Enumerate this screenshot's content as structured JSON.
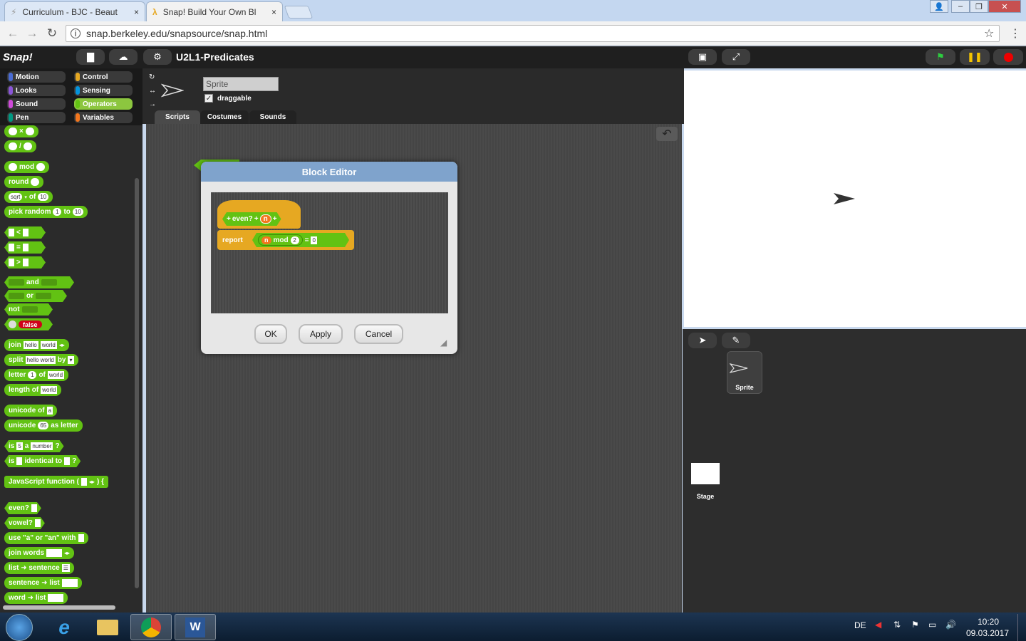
{
  "browser": {
    "tabs": [
      {
        "title": "Curriculum - BJC - Beaut",
        "close": "×"
      },
      {
        "title": "Snap! Build Your Own Bl",
        "close": "×"
      }
    ],
    "url": "snap.berkeley.edu/snapsource/snap.html",
    "window_buttons": [
      "user",
      "minimize",
      "restore",
      "close"
    ]
  },
  "snap": {
    "logo": "Snap!",
    "project_title": "U2L1-Predicates",
    "categories": [
      {
        "label": "Motion",
        "color": "#4a6cd4"
      },
      {
        "label": "Control",
        "color": "#e6a822"
      },
      {
        "label": "Looks",
        "color": "#8a55d7"
      },
      {
        "label": "Sensing",
        "color": "#0494dc"
      },
      {
        "label": "Sound",
        "color": "#cf4ad9"
      },
      {
        "label": "Operators",
        "color": "#62c213"
      },
      {
        "label": "Pen",
        "color": "#009982"
      },
      {
        "label": "Variables",
        "color": "#f3761d"
      }
    ],
    "selected_category": "Operators",
    "palette": {
      "times": "×",
      "divide": "/",
      "mod": "mod",
      "round": "round",
      "sqrt": "sqrt",
      "of": "of",
      "ten": "10",
      "pick_random": "pick random",
      "one": "1",
      "to": "to",
      "lt": "<",
      "eq": "=",
      "gt": ">",
      "and": "and",
      "or": "or",
      "not": "not",
      "false": "false",
      "join": "join",
      "hello": "hello",
      "world": "world",
      "split": "split",
      "hello_world": "hello world",
      "by": "by",
      "letter": "letter",
      "length_of": "length of",
      "unicode_of": "unicode of",
      "a": "a",
      "unicode": "unicode",
      "sixtyfive": "65",
      "as_letter": "as letter",
      "is": "is",
      "five": "5",
      "a_word": "a",
      "number": "number",
      "question": "?",
      "identical_to": "identical to",
      "js_function": "JavaScript function (",
      "js_close": ") {",
      "even": "even?",
      "vowel": "vowel?",
      "use_a_an": "use \"a\" or \"an\" with",
      "join_words": "join words",
      "list_sentence": "list ➜ sentence",
      "sentence_list": "sentence ➜ list",
      "word_list": "word ➜ list"
    },
    "sprite": {
      "name": "Sprite",
      "draggable_label": "draggable",
      "draggable": true
    },
    "tabs": [
      "Scripts",
      "Costumes",
      "Sounds"
    ],
    "block_editor": {
      "title": "Block Editor",
      "hat": {
        "plus": "+",
        "name": "even?",
        "param": "n"
      },
      "report": {
        "label": "report",
        "var": "n",
        "op": "mod",
        "divisor": "2",
        "eq": "=",
        "value": "0"
      },
      "buttons": {
        "ok": "OK",
        "apply": "Apply",
        "cancel": "Cancel"
      }
    },
    "corral": {
      "sprite_label": "Sprite",
      "stage_label": "Stage"
    }
  },
  "taskbar": {
    "language": "DE",
    "time": "10:20",
    "date": "09.03.2017"
  }
}
